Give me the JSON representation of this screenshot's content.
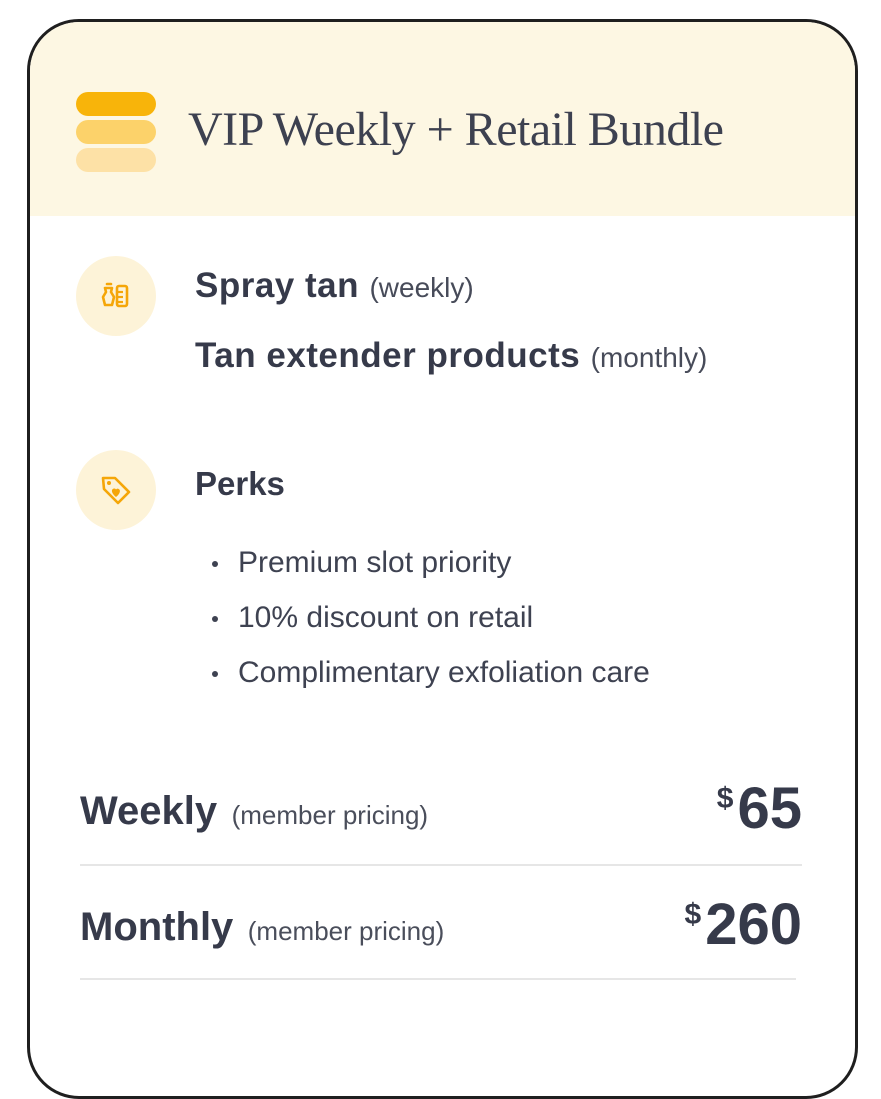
{
  "header": {
    "icon": "stack-icon",
    "title": "VIP Weekly + Retail Bundle",
    "colors": {
      "background": "#fdf7e3",
      "accent": "#f8b40a"
    }
  },
  "services": {
    "icon": "spray-bottle-icon",
    "items": [
      {
        "name": "Spray tan",
        "frequency": "(weekly)"
      },
      {
        "name": "Tan extender products",
        "frequency": "(monthly)"
      }
    ]
  },
  "perks": {
    "icon": "tag-heart-icon",
    "title": "Perks",
    "items": [
      "Premium slot priority",
      "10% discount on retail",
      "Complimentary exfoliation care"
    ]
  },
  "pricing": [
    {
      "period": "Weekly",
      "note": "(member pricing)",
      "currency": "$",
      "amount": "65"
    },
    {
      "period": "Monthly",
      "note": "(member pricing)",
      "currency": "$",
      "amount": "260"
    }
  ]
}
